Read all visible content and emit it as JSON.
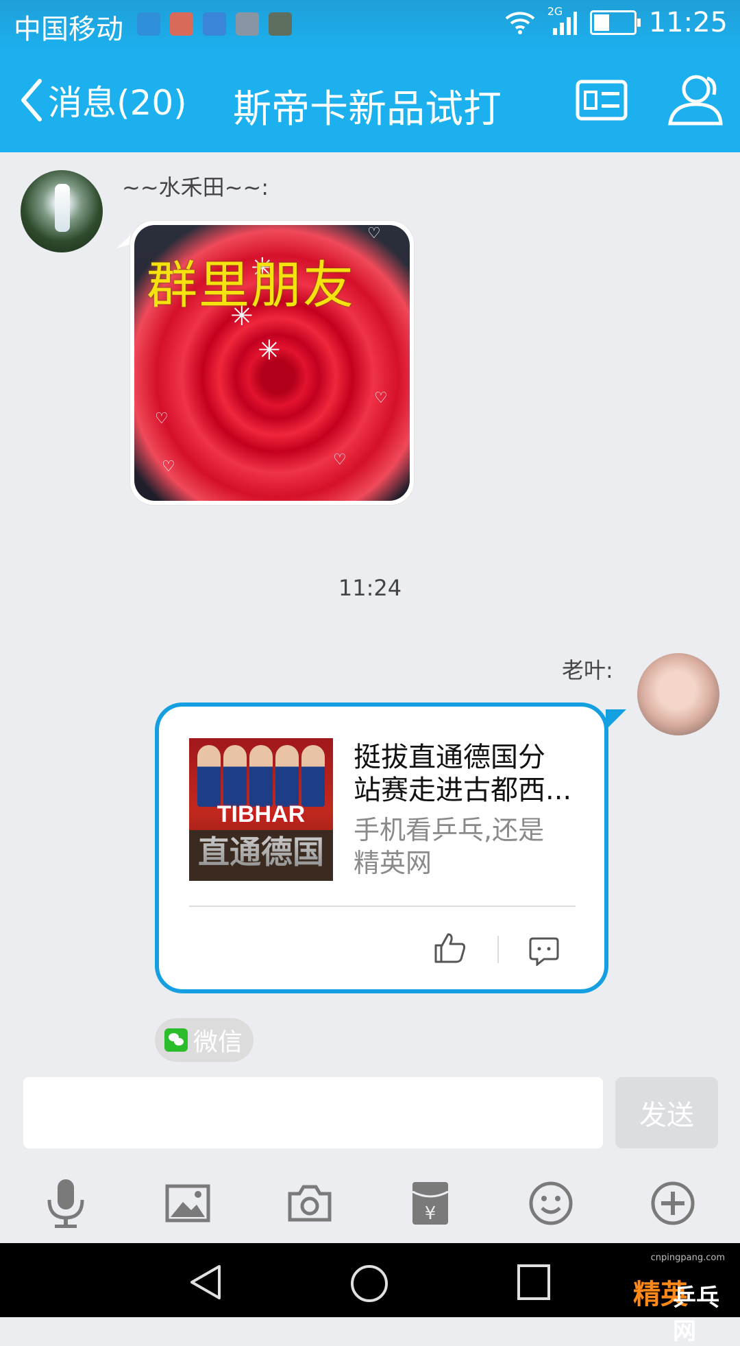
{
  "status_bar": {
    "carrier": "中国移动",
    "network_label": "2G",
    "time": "11:25",
    "battery_level": 0.4
  },
  "header": {
    "back_label": "消息(20)",
    "title": "斯帝卡新品试打"
  },
  "messages": [
    {
      "sender": "~~水禾田~~:",
      "image_caption": "群里朋友"
    },
    {
      "timestamp": "11:24"
    },
    {
      "sender": "老叶:",
      "card": {
        "title_line1": "挺拔直通德国分",
        "title_line2": "站赛走进古都西...",
        "desc_line1": "手机看乒乓,还是",
        "desc_line2": "精英网",
        "thumb_brand": "TIBHAR",
        "thumb_sub": "直通德国"
      },
      "source": "微信"
    }
  ],
  "composer": {
    "value": "",
    "send_label": "发送"
  },
  "toolbar": {
    "items": [
      "microphone-icon",
      "image-icon",
      "camera-icon",
      "red-packet-icon",
      "emoji-icon",
      "plus-icon"
    ]
  },
  "watermark": {
    "url": "cnpingpang.com",
    "brand": "精英",
    "brand2": "乒乓网"
  },
  "colors": {
    "accent": "#1cb0ee",
    "card_border": "#14a0e0",
    "background": "#ecedf1"
  }
}
